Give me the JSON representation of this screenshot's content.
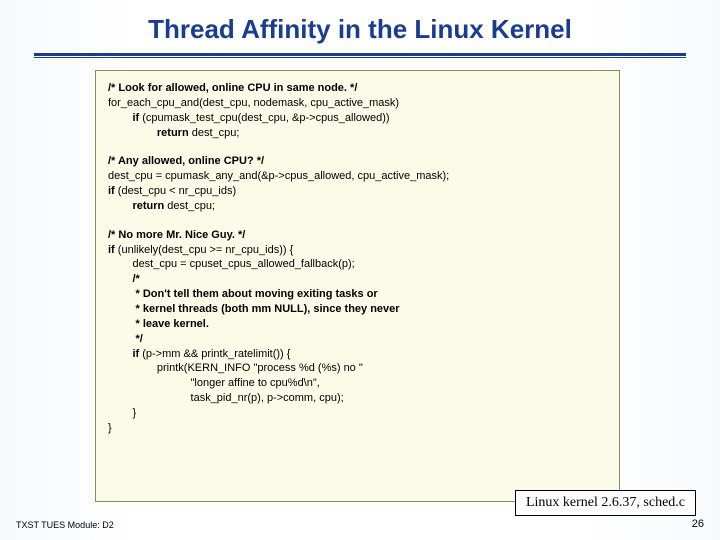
{
  "title": "Thread Affinity in the Linux Kernel",
  "code": {
    "c1_bold": "/* Look for allowed, online CPU in same node. */",
    "c2a": "for_each_cpu_and(dest_cpu, nodemask, cpu_active_mask)",
    "c3_if": "        if",
    "c3_rest": " (cpumask_test_cpu(dest_cpu, &p->cpus_allowed))",
    "c4_ret": "                return",
    "c4_rest": " dest_cpu;",
    "b1_bold": "/* Any allowed, online CPU? */",
    "b2": "dest_cpu = cpumask_any_and(&p->cpus_allowed, cpu_active_mask);",
    "b3_if": "if",
    "b3_rest": " (dest_cpu < nr_cpu_ids)",
    "b4_ret": "        return",
    "b4_rest": " dest_cpu;",
    "d1_bold": "/* No more Mr. Nice Guy. */",
    "d2_if": "if",
    "d2_rest": " (unlikely(dest_cpu >= nr_cpu_ids)) {",
    "d3": "        dest_cpu = cpuset_cpus_allowed_fallback(p);",
    "d4": "        /*",
    "d5": "         * Don't tell them about moving exiting tasks or",
    "d6": "         * kernel threads (both mm NULL), since they never",
    "d7": "         * leave kernel.",
    "d8": "         */",
    "d9_if": "        if",
    "d9_rest": " (p->mm && printk_ratelimit()) {",
    "d10": "                printk(KERN_INFO \"process %d (%s) no \"",
    "d11": "                           \"longer affine to cpu%d\\n\",",
    "d12": "                           task_pid_nr(p), p->comm, cpu);",
    "d13": "        }",
    "d14": "}"
  },
  "cite": "Linux kernel 2.6.37, sched.c",
  "footer_left": "TXST TUES Module: D2",
  "footer_right": "26"
}
